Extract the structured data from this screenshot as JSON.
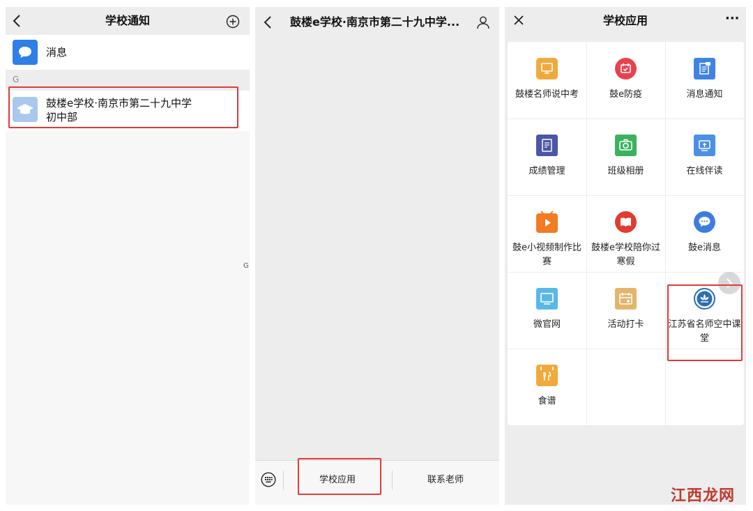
{
  "left_panel": {
    "title": "学校通知",
    "messages_label": "消息",
    "section_letter": "G",
    "school_name_line1": "鼓楼e学校·南京市第二十九中学",
    "school_name_line2": "初中部",
    "index_letter": "G"
  },
  "chat_panel": {
    "title": "鼓楼e学校·南京市第二十九中学...",
    "menu": [
      "学校应用",
      "联系老师"
    ]
  },
  "apps_panel": {
    "title": "学校应用",
    "more": "···",
    "apps": [
      {
        "label": "鼓楼名师说中考",
        "icon": "monitor-icon",
        "color": "#f2a93b"
      },
      {
        "label": "鼓e防疫",
        "icon": "calendar-check-icon",
        "color": "#e8424f"
      },
      {
        "label": "消息通知",
        "icon": "notice-icon",
        "color": "#3f83e6"
      },
      {
        "label": "成绩管理",
        "icon": "report-icon",
        "color": "#4b56a6"
      },
      {
        "label": "班级相册",
        "icon": "camera-icon",
        "color": "#3bb35e"
      },
      {
        "label": "在线伴读",
        "icon": "reading-icon",
        "color": "#4a8fe8"
      },
      {
        "label": "鼓e小视频制作比赛",
        "icon": "video-play-icon",
        "color": "#f37b22"
      },
      {
        "label": "鼓楼e学校陪你过寒假",
        "icon": "book-icon",
        "color": "#e23b2f"
      },
      {
        "label": "鼓e消息",
        "icon": "chat-bubble-icon",
        "color": "#3d7de0"
      },
      {
        "label": "微官网",
        "icon": "screen-icon",
        "color": "#58b8e6"
      },
      {
        "label": "活动打卡",
        "icon": "checkin-icon",
        "color": "#e3b56a"
      },
      {
        "label": "江苏省名师空中课堂",
        "icon": "lotus-emblem-icon",
        "color": "#2b6fb6"
      },
      {
        "label": "食谱",
        "icon": "recipe-icon",
        "color": "#f2a93b"
      }
    ]
  },
  "watermark": "江西龙网"
}
